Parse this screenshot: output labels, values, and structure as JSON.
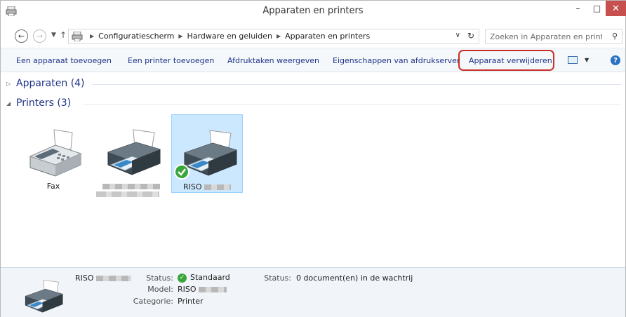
{
  "window": {
    "title": "Apparaten en printers",
    "icons": {
      "app": "devices-printers-icon",
      "minimize": "minimize-icon",
      "maximize": "maximize-icon",
      "close": "close-icon"
    },
    "close_color": "#c7504f"
  },
  "address": {
    "crumbs": [
      "Configuratiescherm",
      "Hardware en geluiden",
      "Apparaten en printers"
    ],
    "search_placeholder": "Zoeken in Apparaten en print..."
  },
  "commands": [
    "Een apparaat toevoegen",
    "Een printer toevoegen",
    "Afdruktaken weergeven",
    "Eigenschappen van afdrukserver",
    "Apparaat verwijderen"
  ],
  "highlight_color": "#c9302c",
  "groups": {
    "devices": "Apparaten (4)",
    "printers": "Printers (3)"
  },
  "printers": [
    {
      "label": "Fax",
      "icon": "fax-icon"
    },
    {
      "label": "",
      "icon": "printer-icon",
      "redacted": true
    },
    {
      "label": "RISO",
      "icon": "printer-icon",
      "selected": true,
      "default": true
    }
  ],
  "details": {
    "name": "RISO",
    "status_label": "Status:",
    "status_value": "Standaard",
    "queue_label": "Status:",
    "queue_value": "0 document(en) in de wachtrij",
    "model_label": "Model:",
    "model_value": "RISO",
    "category_label": "Categorie:",
    "category_value": "Printer"
  }
}
